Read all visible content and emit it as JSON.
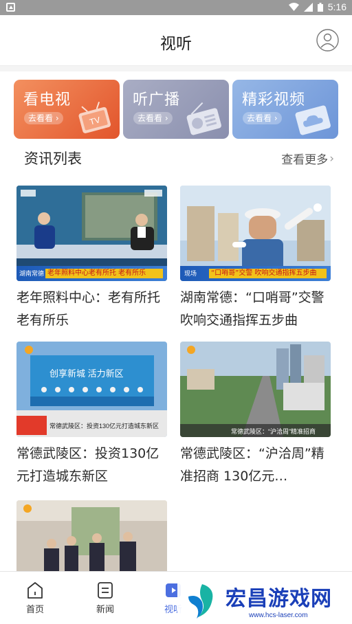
{
  "status_bar": {
    "time": "5:16"
  },
  "header": {
    "title": "视听"
  },
  "categories": [
    {
      "title": "看电视",
      "button": "去看看",
      "accent": "#e86536"
    },
    {
      "title": "听广播",
      "button": "去看看",
      "accent": "#9a9eb9"
    },
    {
      "title": "精彩视频",
      "button": "去看看",
      "accent": "#7ba0dd"
    }
  ],
  "section": {
    "title": "资讯列表",
    "more": "查看更多"
  },
  "news": [
    {
      "title": "老年照料中心：老有所托 老有所乐",
      "thumb_text": "老年照料中心老有所托 老有所乐",
      "thumb_tag": "湖南常德"
    },
    {
      "title": "湖南常德：“口哨哥”交警 吹响交通指挥五步曲",
      "thumb_text": "“口哨哥”交警 吹响交通指挥五步曲",
      "thumb_tag": "现场"
    },
    {
      "title": "常德武陵区：投资130亿元打造城东新区",
      "thumb_text": "常德武陵区：投资130亿元打造城东新区",
      "thumb_tag": "创享新城 活力新区"
    },
    {
      "title": "常德武陵区：“沪洽周”精准招商 130亿元…",
      "thumb_text": "常德武陵区：“沪洽周”精准招商",
      "thumb_tag": ""
    },
    {
      "title": "",
      "thumb_text": "",
      "thumb_tag": ""
    }
  ],
  "bottom_nav": [
    {
      "label": "首页",
      "icon": "home-icon"
    },
    {
      "label": "新闻",
      "icon": "news-icon"
    },
    {
      "label": "视听",
      "icon": "video-icon"
    }
  ],
  "watermark": {
    "title": "宏昌游戏网",
    "url": "www.hcs-laser.com"
  },
  "colors": {
    "accent": "#4c6fe0",
    "statusbar": "#9a9a9a"
  }
}
